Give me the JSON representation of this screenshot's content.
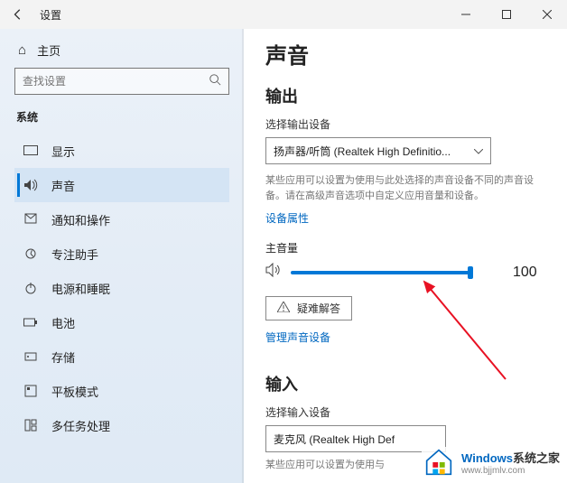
{
  "titlebar": {
    "title": "设置"
  },
  "sidebar": {
    "home_label": "主页",
    "search_placeholder": "查找设置",
    "group_title": "系统",
    "items": [
      {
        "label": "显示"
      },
      {
        "label": "声音"
      },
      {
        "label": "通知和操作"
      },
      {
        "label": "专注助手"
      },
      {
        "label": "电源和睡眠"
      },
      {
        "label": "电池"
      },
      {
        "label": "存储"
      },
      {
        "label": "平板模式"
      },
      {
        "label": "多任务处理"
      }
    ]
  },
  "content": {
    "page_title": "声音",
    "output": {
      "heading": "输出",
      "select_label": "选择输出设备",
      "device": "扬声器/听筒 (Realtek High Definitio...",
      "desc": "某些应用可以设置为使用与此处选择的声音设备不同的声音设备。请在高级声音选项中自定义应用音量和设备。",
      "props_link": "设备属性",
      "volume_label": "主音量",
      "volume_value": "100",
      "troubleshoot": "疑难解答",
      "manage_link": "管理声音设备"
    },
    "input": {
      "heading": "输入",
      "select_label": "选择输入设备",
      "device": "麦克风 (Realtek High Def",
      "desc": "某些应用可以设置为使用与"
    }
  },
  "watermark": {
    "brand": "Windows",
    "brand_zh": "系统之家",
    "url": "www.bjjmlv.com"
  }
}
